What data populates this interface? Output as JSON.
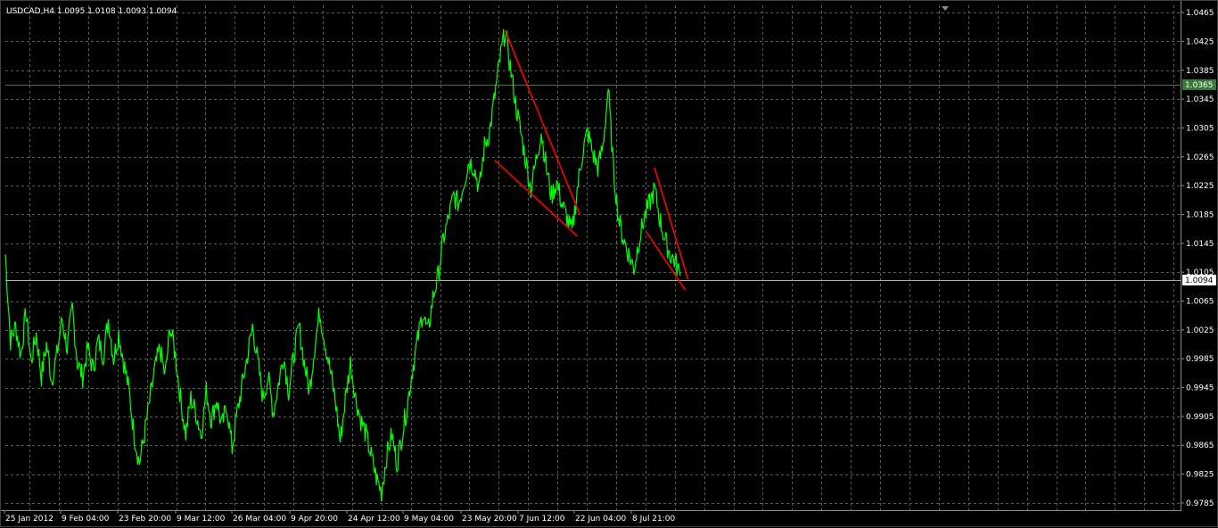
{
  "header": {
    "symbol_line": "USDCAD,H4  1.0095 1.0108 1.0093 1.0094"
  },
  "colors": {
    "background": "#000000",
    "grid": "#5a5a5a",
    "price_line": "#00ff00",
    "trendline": "#ff0000",
    "level_line": "#3a7a3a",
    "bid_line": "#b0b0b0",
    "axis_text": "#ffffff"
  },
  "price_tags": {
    "level": "1.0365",
    "bid": "1.0094"
  },
  "chart_data": {
    "type": "line",
    "title": "USDCAD,H4  1.0095 1.0108 1.0093 1.0094",
    "xlabel": "",
    "ylabel": "",
    "ylim": [
      0.9775,
      1.0475
    ],
    "grid": true,
    "x_tick_labels": [
      "25 Jan 2012",
      "9 Feb 04:00",
      "23 Feb 20:00",
      "9 Mar 12:00",
      "26 Mar 04:00",
      "9 Apr 20:00",
      "24 Apr 12:00",
      "9 May 04:00",
      "23 May 20:00",
      "7 Jun 12:00",
      "22 Jun 04:00",
      "8 Jul 21:00"
    ],
    "y_tick_labels": [
      "1.0465",
      "1.0425",
      "1.0385",
      "1.0345",
      "1.0305",
      "1.0265",
      "1.0225",
      "1.0185",
      "1.0145",
      "1.0105",
      "1.0065",
      "1.0025",
      "0.9985",
      "0.9945",
      "0.9905",
      "0.9865",
      "0.9825",
      "0.9785"
    ],
    "y_ticks": [
      1.0465,
      1.0425,
      1.0385,
      1.0345,
      1.0305,
      1.0265,
      1.0225,
      1.0185,
      1.0145,
      1.0105,
      1.0065,
      1.0025,
      0.9985,
      0.9945,
      0.9905,
      0.9865,
      0.9825,
      0.9785
    ],
    "series": [
      {
        "values": [
          1.013,
          1.001,
          1.003,
          0.999,
          1.005,
          0.998,
          1.002,
          0.996,
          1.0005,
          0.9955,
          0.999,
          1.004,
          1.0,
          1.0055,
          0.998,
          0.996,
          1.0,
          0.997,
          1.001,
          0.999,
          1.004,
          0.9985,
          1.002,
          0.998,
          0.994,
          0.988,
          0.984,
          0.988,
          0.9925,
          0.997,
          1.0,
          0.996,
          1.003,
          0.999,
          0.993,
          0.988,
          0.993,
          0.991,
          0.988,
          0.994,
          0.99,
          0.993,
          0.989,
          0.992,
          0.986,
          0.991,
          0.995,
          0.999,
          1.003,
          0.998,
          0.993,
          0.996,
          0.991,
          0.995,
          0.999,
          0.994,
          0.999,
          1.003,
          0.998,
          0.994,
          1.0,
          1.005,
          1.001,
          0.997,
          0.993,
          0.987,
          0.993,
          0.998,
          0.993,
          0.99,
          0.988,
          0.985,
          0.982,
          0.98,
          0.985,
          0.988,
          0.984,
          0.988,
          0.992,
          0.997,
          1.001,
          1.005,
          1.002,
          1.007,
          1.01,
          1.015,
          1.018,
          1.021,
          1.02,
          1.023,
          1.026,
          1.025,
          1.022,
          1.028,
          1.03,
          1.035,
          1.04,
          1.044,
          1.039,
          1.034,
          1.03,
          1.026,
          1.022,
          1.026,
          1.03,
          1.025,
          1.021,
          1.023,
          1.02,
          1.018,
          1.016,
          1.022,
          1.027,
          1.03,
          1.027,
          1.025,
          1.028,
          1.036,
          1.025,
          1.018,
          1.015,
          1.013,
          1.011,
          1.015,
          1.018,
          1.02,
          1.022,
          1.018,
          1.015,
          1.013,
          1.012,
          1.01
        ]
      }
    ],
    "annotations": [
      {
        "type": "trendline",
        "from": {
          "index": 97.0,
          "value": 1.044
        },
        "to": {
          "index": 111.5,
          "value": 1.0185
        }
      },
      {
        "type": "trendline",
        "from": {
          "index": 95.0,
          "value": 1.026
        },
        "to": {
          "index": 111.0,
          "value": 1.0155
        }
      },
      {
        "type": "trendline",
        "from": {
          "index": 126.0,
          "value": 1.025
        },
        "to": {
          "index": 132.5,
          "value": 1.0095
        }
      },
      {
        "type": "trendline",
        "from": {
          "index": 124.5,
          "value": 1.016
        },
        "to": {
          "index": 132.0,
          "value": 1.008
        }
      }
    ],
    "horizontal_lines": [
      {
        "value": 1.0365,
        "label": "1.0365"
      },
      {
        "value": 1.0094,
        "label": "1.0094"
      }
    ]
  }
}
